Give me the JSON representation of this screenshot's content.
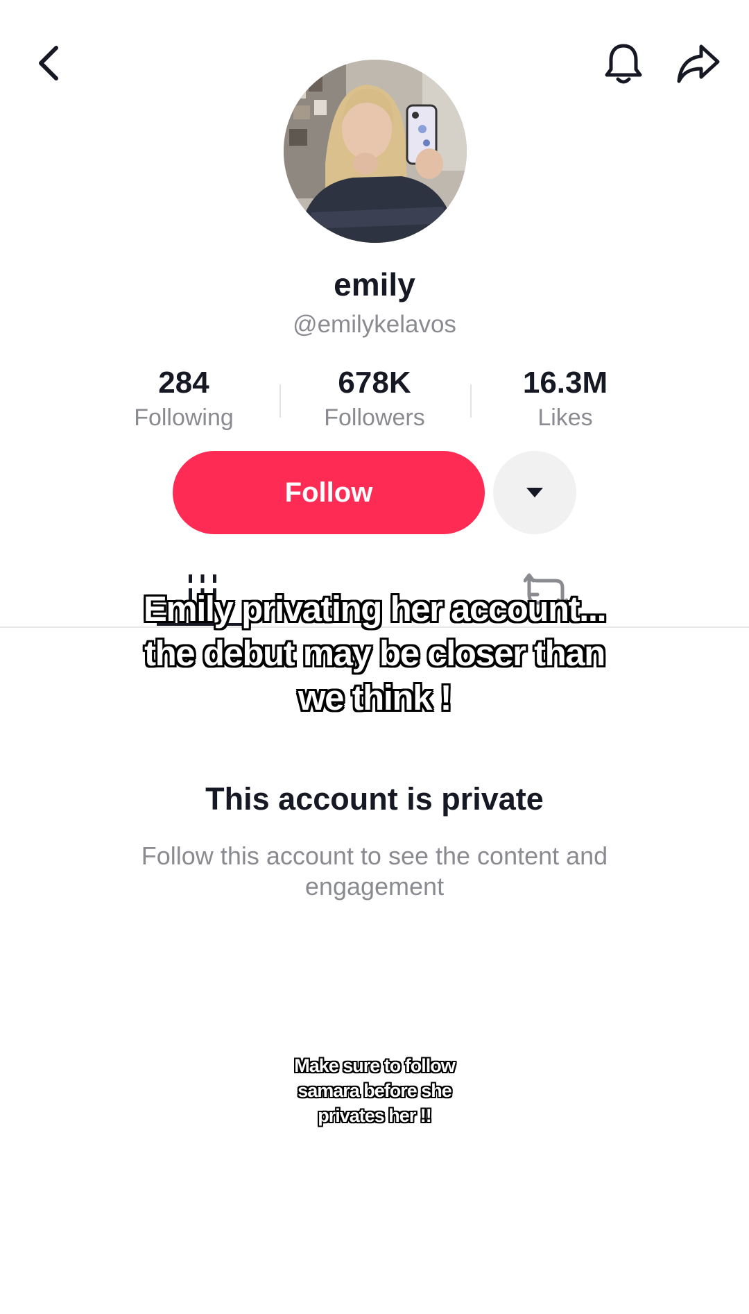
{
  "header": {
    "back_icon": "chevron-left-icon",
    "bell_icon": "bell-icon",
    "share_icon": "share-arrow-icon"
  },
  "profile": {
    "display_name": "emily",
    "handle": "@emilykelavos",
    "avatar": "profile-photo"
  },
  "stats": {
    "following": {
      "value": "284",
      "label": "Following"
    },
    "followers": {
      "value": "678K",
      "label": "Followers"
    },
    "likes": {
      "value": "16.3M",
      "label": "Likes"
    }
  },
  "actions": {
    "follow_label": "Follow",
    "more_icon": "caret-down-icon"
  },
  "tabs": {
    "videos_icon": "grid-icon",
    "reposts_icon": "repost-icon"
  },
  "private": {
    "title": "This account is private",
    "description": "Follow this account to see the content and engagement"
  },
  "overlay": {
    "caption_main": "Emily privating her account... the debut may be closer than we think !",
    "caption_small": "Make sure to follow samara before she privates her !!"
  },
  "colors": {
    "accent": "#fe2c55",
    "text_primary": "#161823",
    "text_secondary": "#8a8b91",
    "button_secondary_bg": "#f1f1f2"
  }
}
